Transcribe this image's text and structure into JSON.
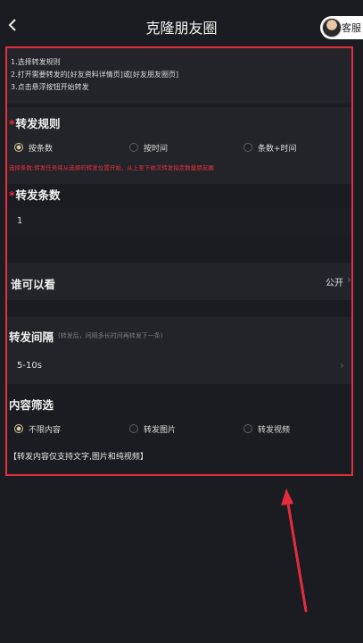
{
  "header": {
    "title": "克隆朋友圈",
    "service_label": "客服"
  },
  "instructions": [
    "1.选择转发规则",
    "2.打开需要转发的[好友资料详情页]或[好友朋友圈页]",
    "3.点击悬浮按钮开始转发"
  ],
  "forward_rule": {
    "required_mark": "*",
    "title": "转发规则",
    "options": [
      "按条数",
      "按时间",
      "条数+时间"
    ],
    "selected": "按条数",
    "warning": "选择条数:转发任务将从选择的转发位置开始，从上至下依次转发指定数量朋友圈"
  },
  "forward_count": {
    "required_mark": "*",
    "title": "转发条数",
    "value": "1"
  },
  "visibility": {
    "label": "谁可以看",
    "value": "公开"
  },
  "interval": {
    "title": "转发间隔",
    "hint": "(转发后，间隔多长时间再转发下一条)",
    "value": "5-10s"
  },
  "content_filter": {
    "title": "内容筛选",
    "options": [
      "不限内容",
      "转发图片",
      "转发视频"
    ],
    "selected": "不限内容",
    "note": "【转发内容仅支持文字,图片和纯视频】"
  },
  "colors": {
    "accent": "#d9c79d",
    "annotation": "#e42d3c",
    "background": "#1b1c21"
  }
}
